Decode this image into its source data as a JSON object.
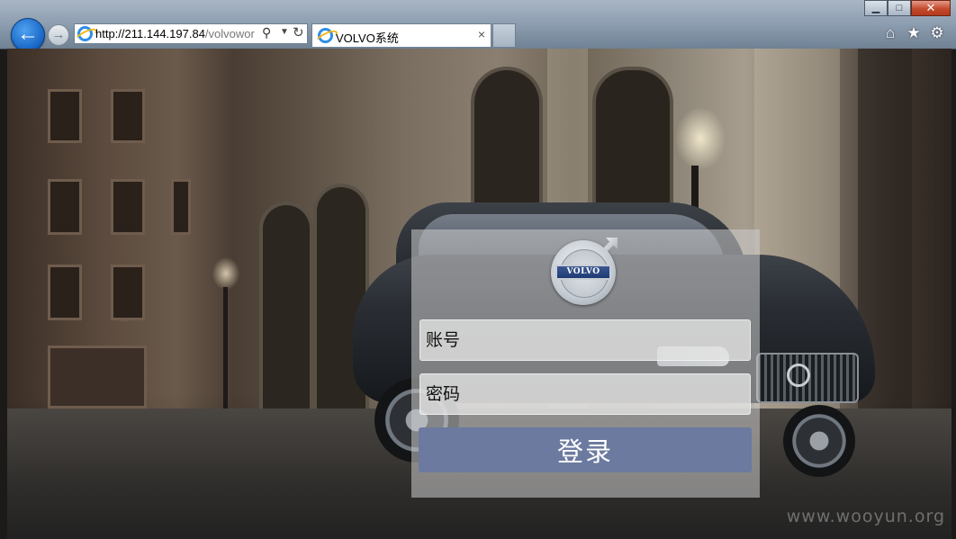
{
  "browser": {
    "address": {
      "url_host": "http://211.144.197.84",
      "url_path": "/volvowor"
    },
    "tab": {
      "title": "VOLVO系统",
      "close_glyph": "×"
    },
    "window_buttons": {
      "minimize": "▁",
      "maximize": "□",
      "close": "✕"
    },
    "icons": {
      "back": "back-arrow-icon",
      "forward": "forward-arrow-icon",
      "search": "search-icon",
      "dropdown": "chevron-down-icon",
      "refresh": "refresh-icon",
      "home": "home-icon",
      "favorites": "star-icon",
      "tools": "gear-icon"
    }
  },
  "login": {
    "logo_text": "VOLVO",
    "account_placeholder": "账号",
    "password_placeholder": "密码",
    "submit_label": "登录"
  },
  "watermark": "www.wooyun.org",
  "colors": {
    "login_button": "#6c7aa0",
    "volvo_blue": "#1e3a73"
  }
}
